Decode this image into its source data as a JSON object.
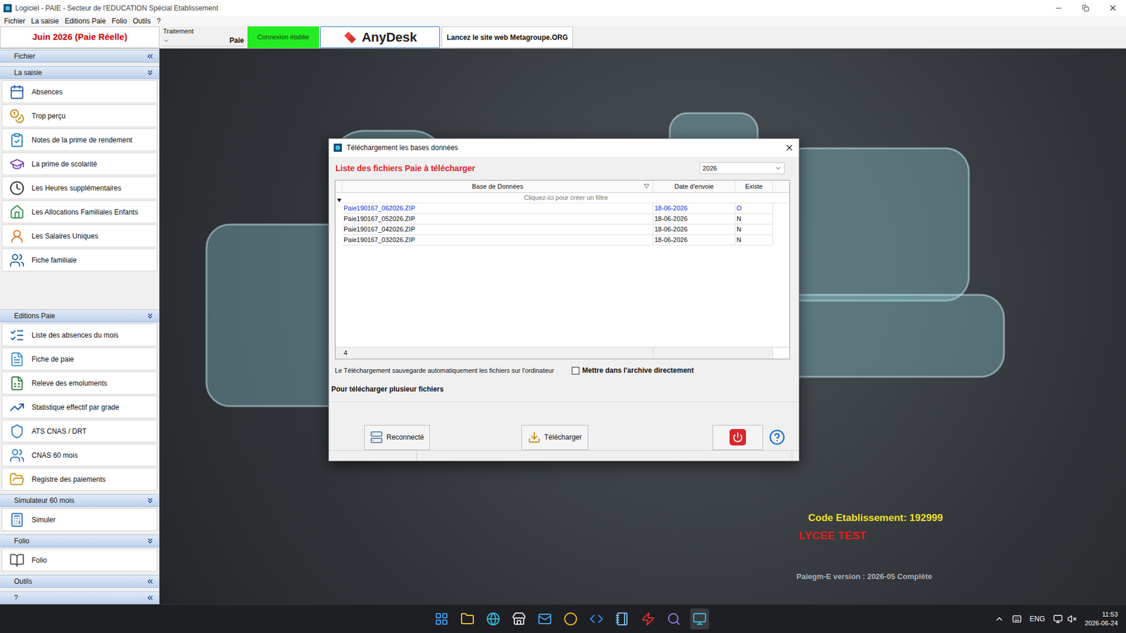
{
  "window": {
    "title": "Logiciel - PAIE - Secteur de l'EDUCATION Spécial Etablissement"
  },
  "menu": [
    "Fichier",
    "La saisie",
    "Editions Paie",
    "Folio",
    "Outils",
    "?"
  ],
  "toolbar": {
    "period": "Juin 2026 (Paie Réelle)",
    "treatment_label": "Traitement",
    "treatment_value": "Paie",
    "connection": "Connexion établie",
    "anydesk": "AnyDesk",
    "website": "Lancez le site web Metagroupe.ORG"
  },
  "sidebar": {
    "sections": [
      {
        "title": "Fichier",
        "expanded": false,
        "items": []
      },
      {
        "title": "La saisie",
        "expanded": true,
        "items": [
          "Absences",
          "Trop perçu",
          "Notes de la prime de rendement",
          "La prime de scolarité",
          "Les Heures supplémentaires",
          "Les Allocations Familiales Enfants",
          "Les Salaires Uniques",
          "Fiche familiale"
        ]
      },
      {
        "title": "Editions Paie",
        "expanded": true,
        "items": [
          "Liste des absences du mois",
          "Fiche de paie",
          "Releve des emoluments",
          "Statistique effectif par grade",
          "ATS CNAS / DRT",
          "CNAS 60 mois",
          "Registre des paiements"
        ]
      },
      {
        "title": "Simulateur 60 mois",
        "expanded": true,
        "items": [
          "Simuler"
        ]
      },
      {
        "title": "Folio",
        "expanded": true,
        "items": [
          "Folio"
        ]
      },
      {
        "title": "Outils",
        "expanded": false,
        "items": []
      },
      {
        "title": "?",
        "expanded": false,
        "items": []
      }
    ]
  },
  "dialog": {
    "title": "Téléchargement les bases données",
    "heading": "Liste des fichiers Paie à télécharger",
    "year": "2026",
    "columns": [
      "Base de Données",
      "Date d'envoie",
      "Existe"
    ],
    "filter_hint": "Cliquez-ici pour créer un filtre",
    "rows": [
      {
        "file": "Paie190167_062026.ZIP",
        "date": "18-06-2026",
        "exists": "O",
        "selected": true
      },
      {
        "file": "Paie190167_052026.ZIP",
        "date": "18-06-2026",
        "exists": "N",
        "selected": false
      },
      {
        "file": "Paie190167_042026.ZIP",
        "date": "18-06-2026",
        "exists": "N",
        "selected": false
      },
      {
        "file": "Paie190167_032026.ZIP",
        "date": "18-06-2026",
        "exists": "N",
        "selected": false
      }
    ],
    "count": "4",
    "note": "Le Téléchargement sauvegarde automatiquement les fichiers sur l'ordinateur",
    "archive": {
      "label": "Mettre dans l'archive directement",
      "checked": false
    },
    "multi_hint": "Pour télécharger plusieur fichiers",
    "buttons": [
      "Reconnecté",
      "Télécharger"
    ]
  },
  "branding": {
    "code": "Code Etablissement: 192999",
    "name": "LYCEE TEST",
    "version": "Paiegm-E version : 2026-05 Complète"
  },
  "taskbar": {
    "language": "ENG",
    "time": "11:53",
    "date": "2026-06-24"
  }
}
